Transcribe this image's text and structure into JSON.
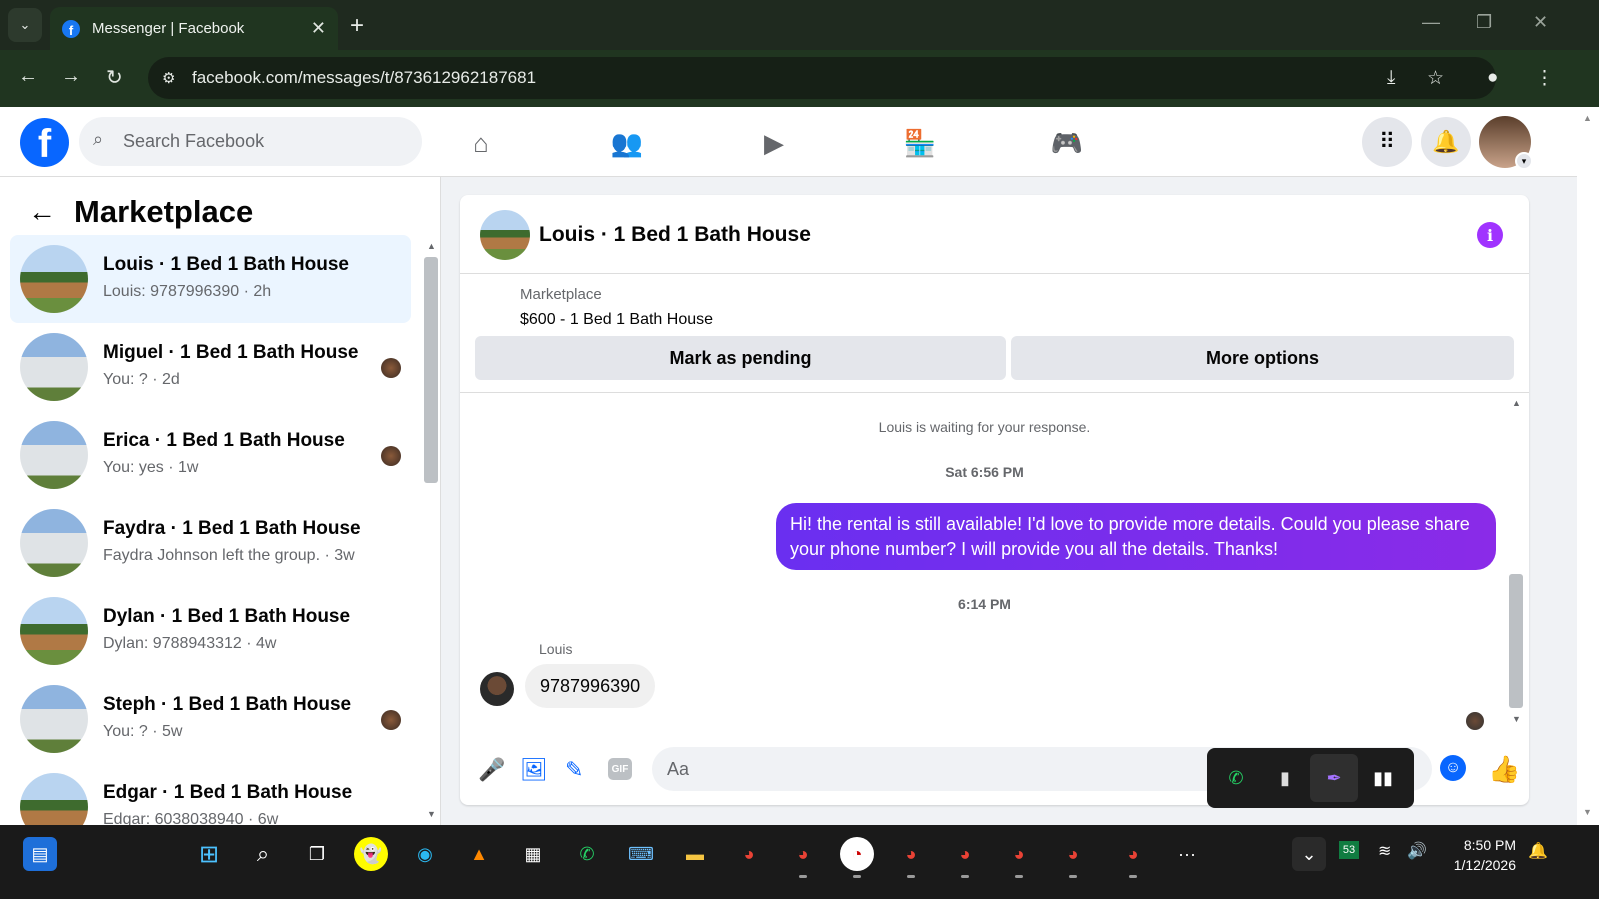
{
  "browser": {
    "tab_title": "Messenger | Facebook",
    "tab_close": "✕",
    "new_tab": "+",
    "url": "facebook.com/messages/t/873612962187681"
  },
  "fb_header": {
    "logo_letter": "f",
    "search_placeholder": "Search Facebook",
    "nav": [
      "home-icon",
      "friends-icon",
      "video-icon",
      "marketplace-icon",
      "gaming-icon"
    ]
  },
  "sidebar": {
    "title": "Marketplace",
    "conversations": [
      {
        "name": "Louis · 1 Bed 1 Bath House",
        "preview": "Louis: 9787996390 · 2h",
        "active": true,
        "seen": false
      },
      {
        "name": "Miguel · 1 Bed 1 Bath House",
        "preview": "You: ? · 2d",
        "active": false,
        "seen": true
      },
      {
        "name": "Erica · 1 Bed 1 Bath House",
        "preview": "You: yes · 1w",
        "active": false,
        "seen": true
      },
      {
        "name": "Faydra · 1 Bed 1 Bath House",
        "preview": "Faydra Johnson left the group. · 3w",
        "active": false,
        "seen": false
      },
      {
        "name": "Dylan · 1 Bed 1 Bath House",
        "preview": "Dylan: 9788943312 · 4w",
        "active": false,
        "seen": false
      },
      {
        "name": "Steph · 1 Bed 1 Bath House",
        "preview": "You: ? · 5w",
        "active": false,
        "seen": true
      },
      {
        "name": "Edgar · 1 Bed 1 Bath House",
        "preview": "Edgar: 6038038940 · 6w",
        "active": false,
        "seen": false
      }
    ]
  },
  "chat": {
    "title": "Louis · 1 Bed 1 Bath House",
    "info_glyph": "i",
    "marketplace_label": "Marketplace",
    "listing": "$600 - 1 Bed 1 Bath House",
    "mark_pending": "Mark as pending",
    "more_options": "More options",
    "waiting_notice": "Louis is waiting for your response.",
    "time1": "Sat 6:56 PM",
    "outgoing_message": "Hi! the rental is still available! I'd love to provide more details. Could you please share your phone number? I will provide you all the details. Thanks!",
    "time2": "6:14 PM",
    "sender_name": "Louis",
    "incoming_message": "9787996390",
    "composer_placeholder": "Aa",
    "gif_label": "GIF"
  },
  "taskbar": {
    "time": "8:50 PM",
    "date": "1/12/2026",
    "battery_badge": "53"
  },
  "colors": {
    "fb_blue": "#0866ff",
    "bubble_purple": "#7b2cf5",
    "active_row": "#ebf5ff"
  }
}
